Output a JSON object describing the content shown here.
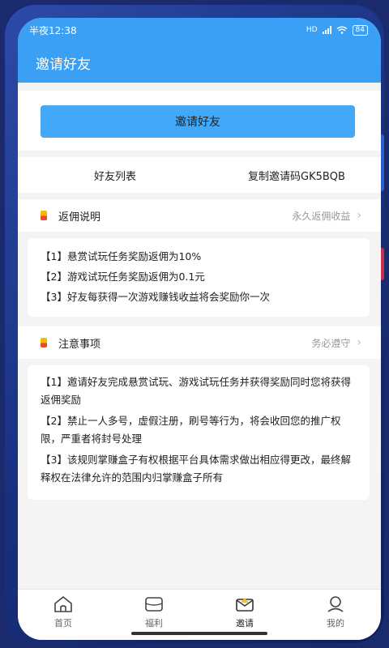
{
  "status": {
    "time": "半夜12:38",
    "battery": "84",
    "network": "HD"
  },
  "appbar": {
    "title": "邀请好友"
  },
  "invite": {
    "button_label": "邀请好友"
  },
  "tabs": {
    "friends_list": "好友列表",
    "copy_code": "复制邀请码GK5BQB"
  },
  "commission": {
    "title": "返佣说明",
    "right": "永久返佣收益",
    "rules": [
      "【1】悬赏试玩任务奖励返佣为10%",
      "【2】游戏试玩任务奖励返佣为0.1元",
      "【3】好友每获得一次游戏赚钱收益将会奖励你一次"
    ]
  },
  "notice": {
    "title": "注意事项",
    "right": "务必遵守",
    "rules": [
      "【1】邀请好友完成悬赏试玩、游戏试玩任务并获得奖励同时您将获得返佣奖励",
      "【2】禁止一人多号，虚假注册，刷号等行为，将会收回您的推广权限，严重者将封号处理",
      "【3】该规则掌赚盒子有权根据平台具体需求做出相应得更改，最终解释权在法律允许的范围内归掌赚盒子所有"
    ]
  },
  "nav": {
    "items": [
      {
        "label": "首页",
        "icon": "home-icon"
      },
      {
        "label": "福利",
        "icon": "welfare-icon"
      },
      {
        "label": "邀请",
        "icon": "invite-icon"
      },
      {
        "label": "我的",
        "icon": "profile-icon"
      }
    ],
    "active": "邀请"
  },
  "colors": {
    "primary": "#3aa0f5",
    "button": "#42a8f7",
    "background": "#f4f4f4"
  }
}
